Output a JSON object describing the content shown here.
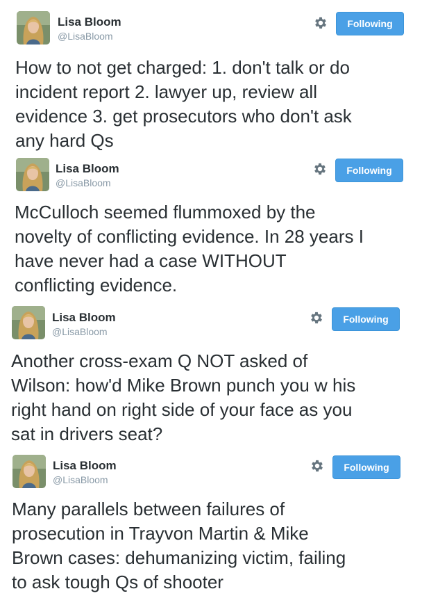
{
  "tweets": [
    {
      "name": "Lisa Bloom",
      "handle": "@LisaBloom",
      "follow_label": "Following",
      "text": "How to not get charged: 1. don't talk or do\nincident report 2. lawyer up, review all\nevidence 3. get prosecutors who don't ask\nany hard Qs"
    },
    {
      "name": "Lisa Bloom",
      "handle": "@LisaBloom",
      "follow_label": "Following",
      "text": "McCulloch seemed flummoxed by the\nnovelty of conflicting evidence. In 28 years I\nhave never had a case WITHOUT\nconflicting evidence."
    },
    {
      "name": "Lisa Bloom",
      "handle": "@LisaBloom",
      "follow_label": "Following",
      "text": "Another cross-exam Q NOT asked of\nWilson: how'd Mike Brown punch you w his\nright hand on right side of your face as you\nsat in drivers seat?"
    },
    {
      "name": "Lisa Bloom",
      "handle": "@LisaBloom",
      "follow_label": "Following",
      "text": "Many parallels between failures of\nprosecution in Trayvon Martin & Mike\nBrown cases: dehumanizing victim, failing\nto ask tough Qs of shooter"
    }
  ],
  "icons": {
    "avatar": "user-photo",
    "settings": "gear-icon"
  },
  "colors": {
    "follow_button": "#4aa0e6",
    "handle": "#8899a6",
    "text": "#292f33"
  }
}
